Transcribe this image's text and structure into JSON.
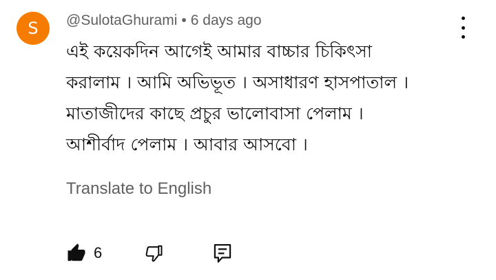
{
  "comment": {
    "avatar_letter": "S",
    "avatar_color": "#f57c00",
    "author": "@SulotaGhurami",
    "separator": "•",
    "time": "6 days ago",
    "text_lines": [
      "এই কয়েকদিন আগেই  আমার বাচ্চার চিকিৎসা",
      "করালাম । আমি অভিভূত । অসাধারণ হাসপাতাল ।",
      "মাতাজীদের কাছে প্রচুর ভালোবাসা পেলাম ।",
      "আশীর্বাদ পেলাম । আবার আসবো ।"
    ],
    "translate_label": "Translate to English",
    "like_count": "6",
    "icons": {
      "more": "more-vert-icon",
      "like": "thumb-up-filled-icon",
      "dislike": "thumb-down-icon",
      "reply": "reply-comment-icon"
    }
  }
}
